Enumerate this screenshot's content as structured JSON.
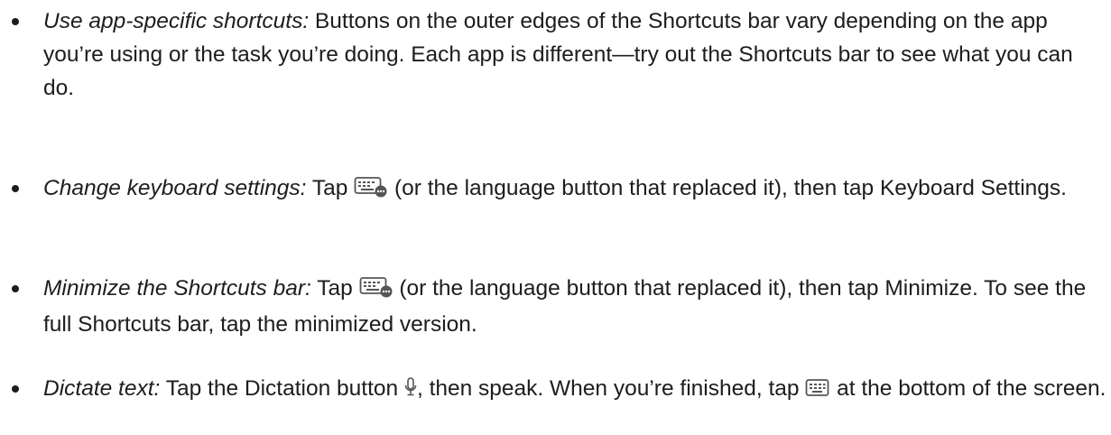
{
  "items": [
    {
      "term": "Use app-specific shortcuts:",
      "text": " Buttons on the outer edges of the Shortcuts bar vary depending on the app you’re using or the task you’re doing. Each app is different—try out the Shortcuts bar to see what you can do."
    },
    {
      "term": "Change keyboard settings:",
      "before": " Tap ",
      "icon": "keyboard-ellipsis-icon",
      "after": " (or the language button that replaced it), then tap Keyboard Settings."
    },
    {
      "term": "Minimize the Shortcuts bar:",
      "before": " Tap ",
      "icon": "keyboard-ellipsis-icon",
      "after": " (or the language button that replaced it), then tap Minimize. To see the full Shortcuts bar, tap the minimized version."
    },
    {
      "term": "Dictate text:",
      "before": " Tap the Dictation button ",
      "icon": "microphone-icon",
      "middle": ", then speak. When you’re finished, tap ",
      "icon2": "keyboard-icon",
      "after": " at the bottom of the screen."
    }
  ]
}
